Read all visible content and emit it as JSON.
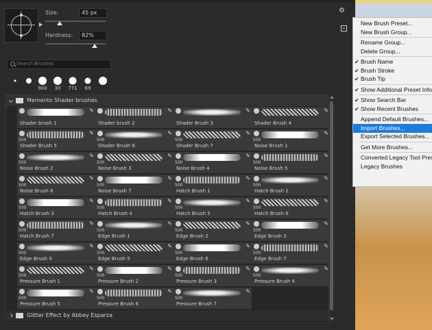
{
  "brush_settings": {
    "size_label": "Size:",
    "size_value": "45 px",
    "size_level": 0.24,
    "hardness_label": "Hardness:",
    "hardness_value": "82%",
    "hardness_level": 0.82
  },
  "search": {
    "placeholder": "Search Brushes"
  },
  "recent_brushes": [
    {
      "label": "",
      "dot": 3
    },
    {
      "label": "",
      "dot": 8
    },
    {
      "label": "900",
      "dot": 12
    },
    {
      "label": "30",
      "dot": 12
    },
    {
      "label": "771",
      "dot": 11
    },
    {
      "label": "69",
      "dot": 9
    },
    {
      "label": "",
      "dot": 12
    }
  ],
  "groups": {
    "memento": "Memento Shader brushes",
    "glitter": "Glitter Effect by Abbey Esparza"
  },
  "brushes": [
    {
      "name": "Shader brush 1",
      "size": ""
    },
    {
      "name": "Shader brush 2",
      "size": ""
    },
    {
      "name": "Shader Brush 3",
      "size": ""
    },
    {
      "name": "Shader Brush 4",
      "size": ""
    },
    {
      "name": "Shader Brush 5",
      "size": "500"
    },
    {
      "name": "Shader Brush 6",
      "size": "500"
    },
    {
      "name": "Shader Brush 7",
      "size": "500"
    },
    {
      "name": "Noise Brush 1",
      "size": "500"
    },
    {
      "name": "Noise Brush 2",
      "size": "500"
    },
    {
      "name": "Noise Brush 3",
      "size": "500"
    },
    {
      "name": "Noise Brush 4",
      "size": "500"
    },
    {
      "name": "Noise Brush 5",
      "size": "500"
    },
    {
      "name": "Noise Brush 6",
      "size": "500"
    },
    {
      "name": "Noise Brush 7",
      "size": "500"
    },
    {
      "name": "Hatch Brush 1",
      "size": "500"
    },
    {
      "name": "Hatch Brush 2",
      "size": "500"
    },
    {
      "name": "Hatch Brush 3",
      "size": "500"
    },
    {
      "name": "Hatch Brush 4",
      "size": "500"
    },
    {
      "name": "Hatch Brush 5",
      "size": "500"
    },
    {
      "name": "Hatch Brush 6",
      "size": "500"
    },
    {
      "name": "Hatch Brush 7",
      "size": "500"
    },
    {
      "name": "Edge Brush 1",
      "size": "500"
    },
    {
      "name": "Edge Brush 2",
      "size": "500"
    },
    {
      "name": "Edge Brush 3",
      "size": "500"
    },
    {
      "name": "Edge Brush 4",
      "size": "500"
    },
    {
      "name": "Edge Brush 5",
      "size": "500"
    },
    {
      "name": "Edge Brush 6",
      "size": "500"
    },
    {
      "name": "Edge Brush 7",
      "size": "500"
    },
    {
      "name": "Pressure Brush 1",
      "size": "500"
    },
    {
      "name": "Pressure Brush 2",
      "size": "500"
    },
    {
      "name": "Pressure Brush 3",
      "size": "500"
    },
    {
      "name": "Pressure Brush 4",
      "size": "500"
    },
    {
      "name": "Pressure Brush 5",
      "size": "500"
    },
    {
      "name": "Pressure Brush 6",
      "size": "500"
    },
    {
      "name": "Pressure Brush 7",
      "size": "500"
    }
  ],
  "menu": [
    {
      "label": "New Brush Preset...",
      "checked": false
    },
    {
      "label": "New Brush Group...",
      "checked": false
    },
    {
      "sep": true
    },
    {
      "label": "Rename Group...",
      "checked": false
    },
    {
      "label": "Delete Group...",
      "checked": false
    },
    {
      "sep": true
    },
    {
      "label": "Brush Name",
      "checked": true
    },
    {
      "label": "Brush Stroke",
      "checked": true
    },
    {
      "label": "Brush Tip",
      "checked": true
    },
    {
      "sep": true
    },
    {
      "label": "Show Additional Preset Info",
      "checked": true
    },
    {
      "sep": true
    },
    {
      "label": "Show Search Bar",
      "checked": true
    },
    {
      "label": "Show Recent Brushes",
      "checked": true
    },
    {
      "sep": true
    },
    {
      "label": "Append Default Brushes...",
      "checked": false
    },
    {
      "label": "Import Brushes...",
      "checked": false,
      "highlighted": true
    },
    {
      "label": "Export Selected Brushes...",
      "checked": false
    },
    {
      "sep": true
    },
    {
      "label": "Get More Brushes...",
      "checked": false
    },
    {
      "sep": true
    },
    {
      "label": "Converted Legacy Tool Presets",
      "checked": false
    },
    {
      "label": "Legacy Brushes",
      "checked": false
    }
  ]
}
